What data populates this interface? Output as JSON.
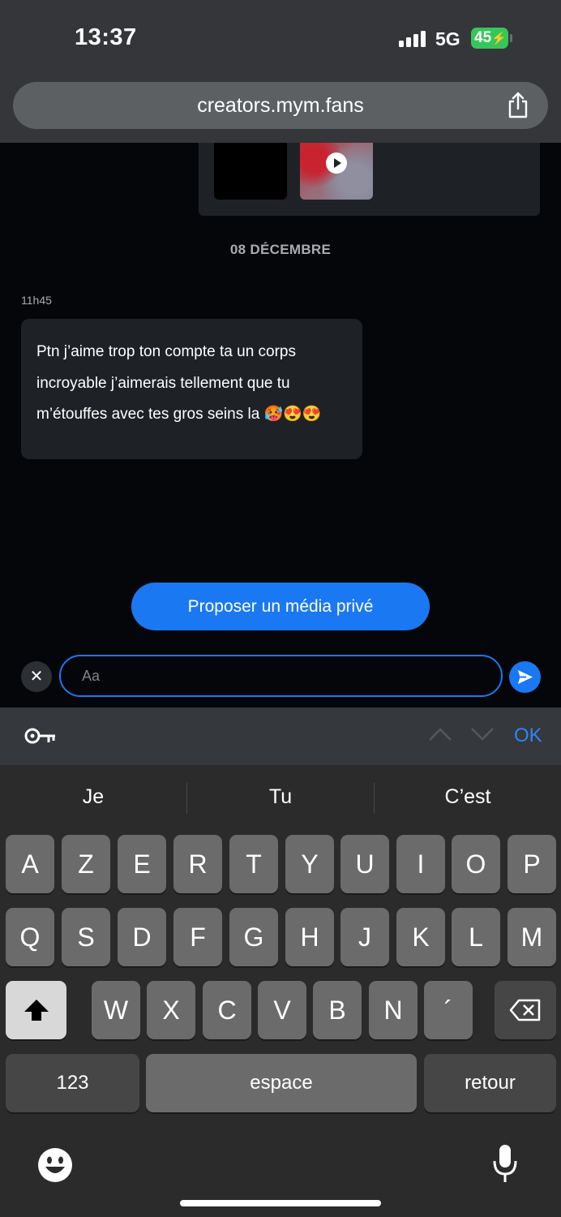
{
  "status_bar": {
    "time": "13:37",
    "network": "5G",
    "battery": "45"
  },
  "browser": {
    "url": "creators.mym.fans"
  },
  "chat": {
    "date_separator": "08 DÉCEMBRE",
    "message": {
      "time": "11h45",
      "text": "Ptn j’aime trop ton compte ta un corps incroyable j’aimerais tellement que tu m’étouffes avec tes gros seins la 🥵😍😍"
    },
    "propose_button": "Proposer un média privé",
    "input": {
      "placeholder": "Aa",
      "value": ""
    }
  },
  "accessory_bar": {
    "ok_label": "OK"
  },
  "keyboard": {
    "suggestions": [
      "Je",
      "Tu",
      "C’est"
    ],
    "row1": [
      "A",
      "Z",
      "E",
      "R",
      "T",
      "Y",
      "U",
      "I",
      "O",
      "P"
    ],
    "row2": [
      "Q",
      "S",
      "D",
      "F",
      "G",
      "H",
      "J",
      "K",
      "L",
      "M"
    ],
    "row3": [
      "W",
      "X",
      "C",
      "V",
      "B",
      "N",
      "´"
    ],
    "numbers_label": "123",
    "space_label": "espace",
    "return_label": "retour"
  },
  "colors": {
    "accent": "#1a78f2",
    "battery": "#35c759",
    "ok": "#2e86f5"
  }
}
